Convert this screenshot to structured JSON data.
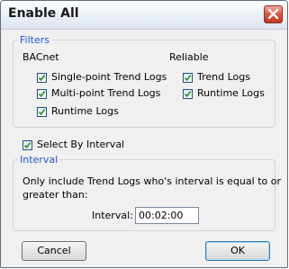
{
  "window": {
    "title": "Enable All"
  },
  "filters": {
    "legend": "Filters",
    "bacnet": {
      "label": "BACnet",
      "items": [
        {
          "label": "Single-point Trend Logs",
          "checked": true
        },
        {
          "label": "Multi-point Trend Logs",
          "checked": true
        },
        {
          "label": "Runtime Logs",
          "checked": true
        }
      ]
    },
    "reliable": {
      "label": "Reliable",
      "items": [
        {
          "label": "Trend Logs",
          "checked": true
        },
        {
          "label": "Runtime Logs",
          "checked": true
        }
      ]
    }
  },
  "select_by_interval": {
    "label": "Select By Interval",
    "checked": true
  },
  "interval": {
    "legend": "Interval",
    "description_line1": "Only include Trend Logs who's interval is equal to or",
    "description_line2": "greater than:",
    "field_label": "Interval:",
    "value": "00:02:00"
  },
  "buttons": {
    "cancel": "Cancel",
    "ok": "OK"
  },
  "colors": {
    "legend": "#1b59d6",
    "close_button": "#d9573f",
    "checkbox_border": "#1c5180",
    "checkmark": "#2a9a2a"
  },
  "icons": {
    "close": "close-icon",
    "check": "checkmark-icon"
  }
}
